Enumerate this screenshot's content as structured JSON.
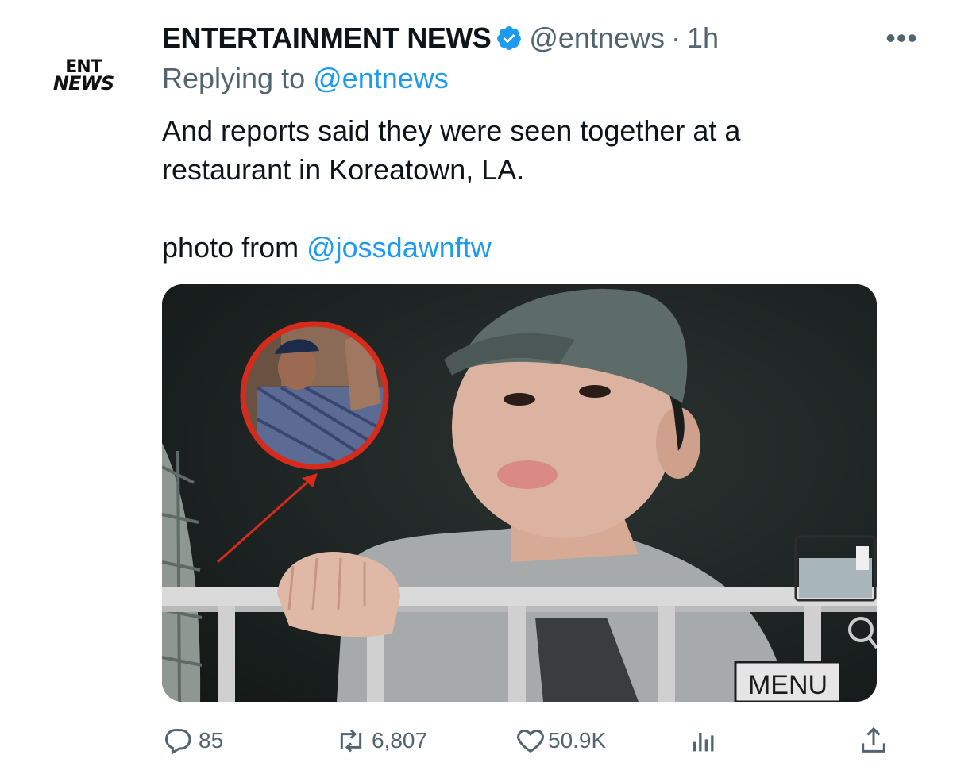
{
  "tweet": {
    "author_avatar_line1": "ENT",
    "author_avatar_line2": "NEWS",
    "author_name": "ENTERTAINMENT NEWS",
    "author_handle": "@entnews",
    "separator": "·",
    "time": "1h",
    "more_icon": "more-horizontal-icon",
    "replying_prefix": "Replying to",
    "replying_to": "@entnews",
    "text_line1": "And reports said they were seen together at a",
    "text_line2": "restaurant in Koreatown, LA.",
    "text_line3_prefix": "photo from",
    "photo_credit": "@jossdawnftw",
    "media": {
      "camera_menu_label": "MENU"
    }
  },
  "actions": {
    "reply": {
      "icon": "reply-icon",
      "count": "85"
    },
    "retweet": {
      "icon": "retweet-icon",
      "count": "6,807"
    },
    "like": {
      "icon": "heart-icon",
      "count": "50.9K"
    },
    "analytics": {
      "icon": "analytics-icon"
    },
    "share": {
      "icon": "share-icon"
    }
  },
  "colors": {
    "accent": "#1d9bf0",
    "secondary_text": "#536471",
    "primary_text": "#0f1419"
  }
}
